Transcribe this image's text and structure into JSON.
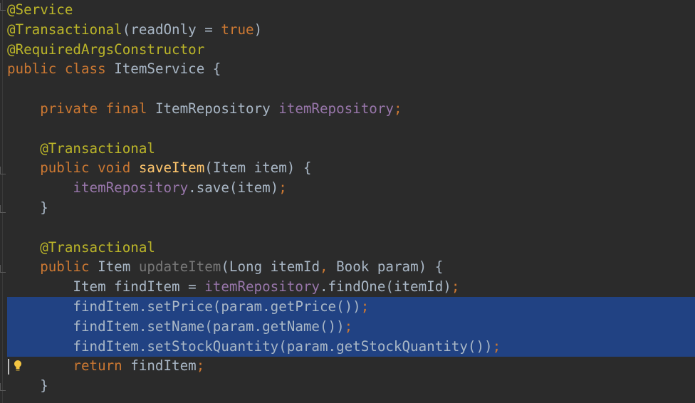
{
  "editor": {
    "colors": {
      "background": "#2b2b2b",
      "selection": "#214283",
      "annotation": "#bbb529",
      "keyword": "#cc7832",
      "text": "#a9b7c6",
      "field": "#9876aa",
      "method_declaration": "#ffc66d",
      "unused_method": "#787878"
    },
    "lines": [
      {
        "tokens": [
          {
            "t": "@Service",
            "c": "annot"
          }
        ]
      },
      {
        "tokens": [
          {
            "t": "@Transactional",
            "c": "annot"
          },
          {
            "t": "(readOnly = ",
            "c": "plain"
          },
          {
            "t": "true",
            "c": "kw"
          },
          {
            "t": ")",
            "c": "plain"
          }
        ]
      },
      {
        "tokens": [
          {
            "t": "@RequiredArgsConstructor",
            "c": "annot"
          }
        ]
      },
      {
        "tokens": [
          {
            "t": "public class ",
            "c": "kw"
          },
          {
            "t": "ItemService {",
            "c": "plain"
          }
        ]
      },
      {
        "tokens": []
      },
      {
        "tokens": [
          {
            "t": "    private final ",
            "c": "kw"
          },
          {
            "t": "ItemRepository ",
            "c": "plain"
          },
          {
            "t": "itemRepository",
            "c": "field"
          },
          {
            "t": ";",
            "c": "punct"
          }
        ]
      },
      {
        "tokens": []
      },
      {
        "tokens": [
          {
            "t": "    @Transactional",
            "c": "annot"
          }
        ]
      },
      {
        "tokens": [
          {
            "t": "    public void ",
            "c": "kw"
          },
          {
            "t": "saveItem",
            "c": "method"
          },
          {
            "t": "(Item item) {",
            "c": "plain"
          }
        ]
      },
      {
        "tokens": [
          {
            "t": "        itemRepository",
            "c": "field"
          },
          {
            "t": ".save(item)",
            "c": "plain"
          },
          {
            "t": ";",
            "c": "punct"
          }
        ]
      },
      {
        "tokens": [
          {
            "t": "    }",
            "c": "plain"
          }
        ]
      },
      {
        "tokens": []
      },
      {
        "tokens": [
          {
            "t": "    @Transactional",
            "c": "annot"
          }
        ]
      },
      {
        "tokens": [
          {
            "t": "    public ",
            "c": "kw"
          },
          {
            "t": "Item ",
            "c": "plain"
          },
          {
            "t": "updateItem",
            "c": "unused"
          },
          {
            "t": "(Long itemId",
            "c": "plain"
          },
          {
            "t": ", ",
            "c": "punct"
          },
          {
            "t": "Book param) {",
            "c": "plain"
          }
        ]
      },
      {
        "tokens": [
          {
            "t": "        Item findItem = ",
            "c": "plain"
          },
          {
            "t": "itemRepository",
            "c": "field"
          },
          {
            "t": ".findOne(itemId)",
            "c": "plain"
          },
          {
            "t": ";",
            "c": "punct"
          }
        ]
      },
      {
        "selected": true,
        "tokens": [
          {
            "t": "        findItem.setPrice(param.getPrice())",
            "c": "plain"
          },
          {
            "t": ";",
            "c": "punct"
          }
        ]
      },
      {
        "selected": true,
        "tokens": [
          {
            "t": "        findItem.setName(param.getName())",
            "c": "plain"
          },
          {
            "t": ";",
            "c": "punct"
          }
        ]
      },
      {
        "selected": true,
        "tokens": [
          {
            "t": "        findItem.setStockQuantity(param.getStockQuantity())",
            "c": "plain"
          },
          {
            "t": ";",
            "c": "punct"
          }
        ]
      },
      {
        "tokens": [
          {
            "t": "        return ",
            "c": "kw"
          },
          {
            "t": "findItem",
            "c": "plain"
          },
          {
            "t": ";",
            "c": "punct"
          }
        ]
      },
      {
        "tokens": [
          {
            "t": "    }",
            "c": "plain"
          }
        ]
      }
    ],
    "gutter": {
      "intention_icon": "lightbulb-icon"
    }
  }
}
